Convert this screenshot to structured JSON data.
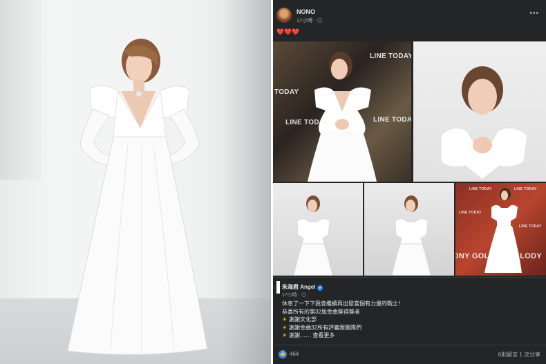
{
  "post": {
    "author": "NONO",
    "time": "17小時",
    "reaction_text": "❤️❤️❤️",
    "photo_wall_text": {
      "line_today": "LINE TODAY",
      "today_partial": "TODAY",
      "melody": "ONY GOLDEN MELODY"
    }
  },
  "shared_post": {
    "author": "朱海君 Angel",
    "time": "17小時",
    "lines": [
      "休息了一下下我會繼續再出發當個有力量的戰士！",
      "恭喜所有的第32屆金曲獎得獎者",
      "謝謝文化部",
      "謝謝金曲32所有評審跟團隊們",
      "謝謝……"
    ],
    "see_more": "查看更多"
  },
  "footer": {
    "reaction_count": "464",
    "comments": "6則留言",
    "shares": "1 次分享"
  },
  "colors": {
    "panel_bg": "#242526",
    "text": "#e4e6eb",
    "muted": "#b0b3b8",
    "accent_blue": "#2d88ff",
    "heart": "#e0245e"
  },
  "icons": {
    "verified": "verified-badge-icon",
    "globe": "globe-icon",
    "like": "thumbs-up-icon",
    "more": "more-horizontal-icon",
    "sun": "sun-emoji-icon"
  }
}
